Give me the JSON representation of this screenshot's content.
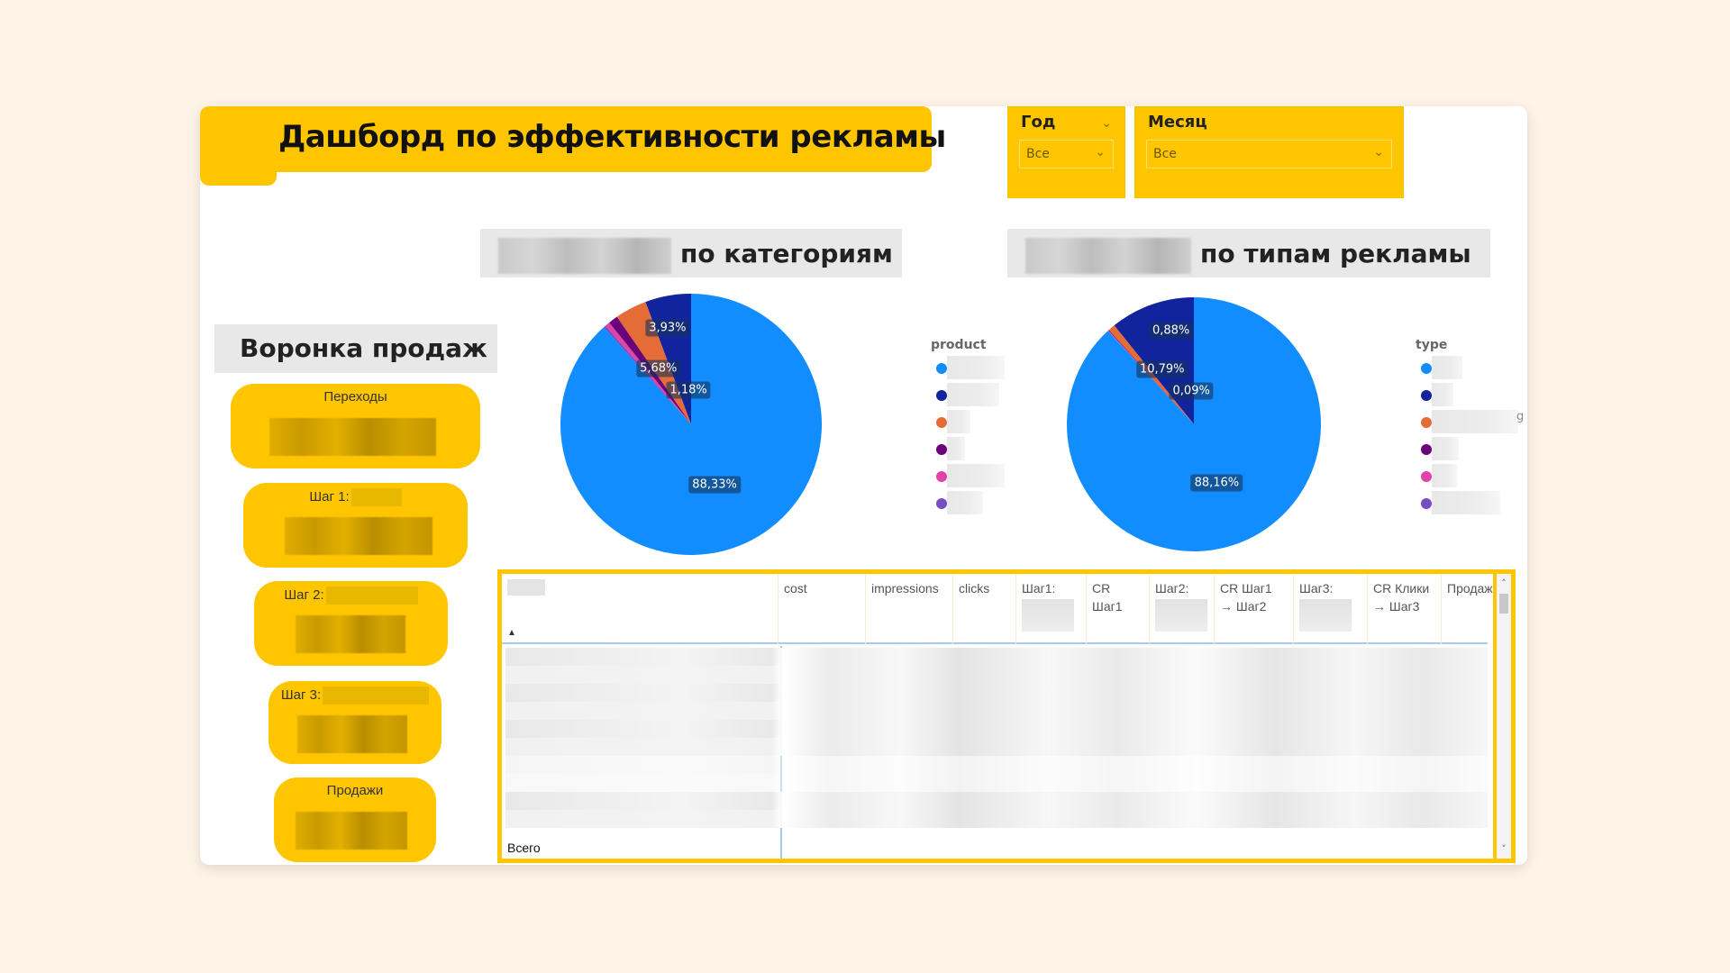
{
  "header": {
    "title": "Дашборд по эффективности рекламы"
  },
  "filters": {
    "year": {
      "label": "Год",
      "value": "Все",
      "icon": "chevron-down-icon"
    },
    "month": {
      "label": "Месяц",
      "value": "Все",
      "icon": "chevron-down-icon"
    }
  },
  "sections": {
    "categories_title": "по категориям",
    "types_title": "по типам рекламы",
    "funnel_title": "Воронка продаж"
  },
  "funnel": {
    "steps": [
      {
        "label": "Переходы",
        "label_redacted": false
      },
      {
        "label": "Шаг 1:",
        "label_redacted": true
      },
      {
        "label": "Шаг 2:",
        "label_redacted": true
      },
      {
        "label": "Шаг 3:",
        "label_redacted": true
      },
      {
        "label": "Продажи",
        "label_redacted": false
      }
    ]
  },
  "colors": {
    "accent": "#ffc600",
    "background": "#fdf3e7",
    "series": [
      "#118dff",
      "#12239e",
      "#e66c37",
      "#6b007b",
      "#e044a7",
      "#744ec2"
    ]
  },
  "chart_data": [
    {
      "type": "pie",
      "title": "… по категориям",
      "legend_title": "product",
      "legend_position": "right",
      "categories": [
        "(redacted 1)",
        "(redacted 2)",
        "(redacted 3)",
        "(redacted 4)",
        "(redacted 5)",
        "(redacted 6)"
      ],
      "colors": [
        "#118dff",
        "#12239e",
        "#e66c37",
        "#6b007b",
        "#e044a7",
        "#744ec2"
      ],
      "values": [
        88.33,
        5.68,
        3.93,
        1.18,
        0.6,
        0.28
      ],
      "labels": [
        "88,33%",
        "5,68%",
        "3,93%",
        "1,18%",
        "",
        ""
      ]
    },
    {
      "type": "pie",
      "title": "… по типам рекламы",
      "legend_title": "type",
      "legend_position": "right",
      "categories": [
        "(redacted 1)",
        "(redacted 2)",
        "(redacted 3)",
        "(redacted 4)",
        "(redacted 5)",
        "(redacted 6)"
      ],
      "colors": [
        "#118dff",
        "#12239e",
        "#e66c37",
        "#6b007b",
        "#e044a7",
        "#744ec2"
      ],
      "values": [
        88.16,
        10.79,
        0.88,
        0.09,
        0.05,
        0.03
      ],
      "labels": [
        "88,16%",
        "10,79%",
        "0,88%",
        "0,09%",
        "",
        ""
      ],
      "legend_overflow_glyph": "g"
    }
  ],
  "table": {
    "columns": [
      {
        "label": "",
        "redacted": true
      },
      {
        "label": "cost",
        "redacted": false
      },
      {
        "label": "impressions",
        "redacted": false
      },
      {
        "label": "clicks",
        "redacted": false
      },
      {
        "label": "Шаг1:",
        "redacted": true
      },
      {
        "label": "CR Шаг1",
        "redacted": false
      },
      {
        "label": "Шаг2:",
        "redacted": true
      },
      {
        "label": "CR Шаг1 → Шаг2",
        "redacted": false
      },
      {
        "label": "Шаг3:",
        "redacted": true
      },
      {
        "label": "CR Клики → Шаг3",
        "redacted": false
      },
      {
        "label": "Продаж",
        "redacted": false
      }
    ],
    "sort_icon": "sort-ascending-icon",
    "total_label": "Всего",
    "scroll_up": "˄",
    "scroll_down": "˅"
  }
}
